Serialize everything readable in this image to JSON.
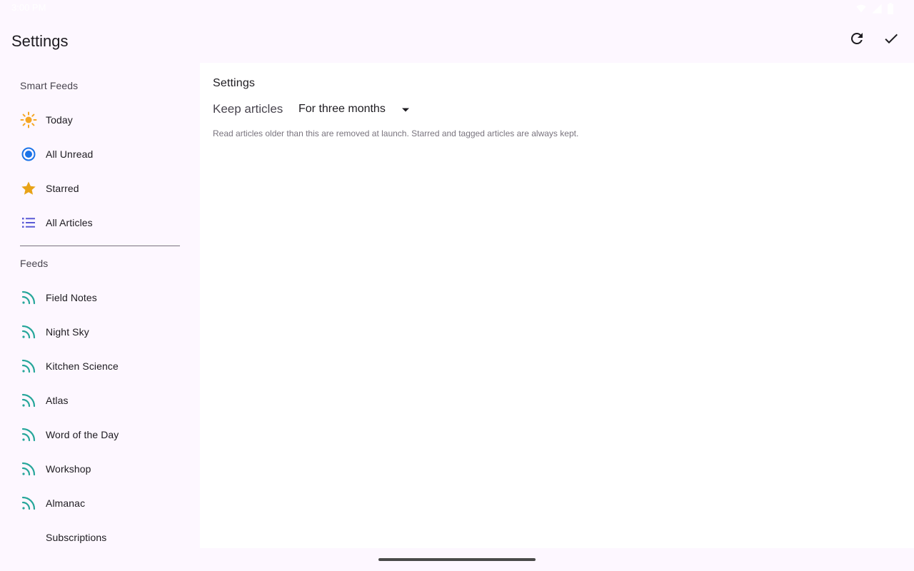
{
  "status_bar": {
    "time": "3:00 PM",
    "icons": [
      "wifi-icon",
      "signal-icon",
      "battery-icon"
    ]
  },
  "app_bar": {
    "title": "Settings",
    "actions": [
      {
        "name": "refresh-icon"
      },
      {
        "name": "checkmark-icon"
      }
    ]
  },
  "sidebar": {
    "smart_feeds_header": "Smart Feeds",
    "smart_feeds": [
      {
        "label": "Today",
        "icon": "sun-icon",
        "color": "#f5a623"
      },
      {
        "label": "All Unread",
        "icon": "radio-dot-icon",
        "color": "#1a73e8"
      },
      {
        "label": "Starred",
        "icon": "star-icon",
        "color": "#e8a317"
      },
      {
        "label": "All Articles",
        "icon": "list-icon",
        "color": "#5b5bd6"
      }
    ],
    "feeds_header": "Feeds",
    "feeds": [
      {
        "label": "Field Notes",
        "icon": "rss-icon"
      },
      {
        "label": "Night Sky",
        "icon": "rss-icon"
      },
      {
        "label": "Kitchen Science",
        "icon": "rss-icon"
      },
      {
        "label": "Atlas",
        "icon": "rss-icon"
      },
      {
        "label": "Word of the Day",
        "icon": "rss-icon"
      },
      {
        "label": "Workshop",
        "icon": "rss-icon"
      },
      {
        "label": "Almanac",
        "icon": "rss-icon"
      }
    ],
    "subscriptions_label": "Subscriptions",
    "feed_icon_color": "#26a69a"
  },
  "content": {
    "title": "Settings",
    "keep_articles_label": "Keep articles",
    "keep_articles_value": "For three months",
    "help_text": "Read articles older than this are removed at launch. Starred and tagged articles are always kept."
  },
  "colors": {
    "background": "#fdf7ff",
    "content_background": "#ffffff",
    "text_primary": "#1d1b20",
    "text_secondary": "#49454f"
  }
}
